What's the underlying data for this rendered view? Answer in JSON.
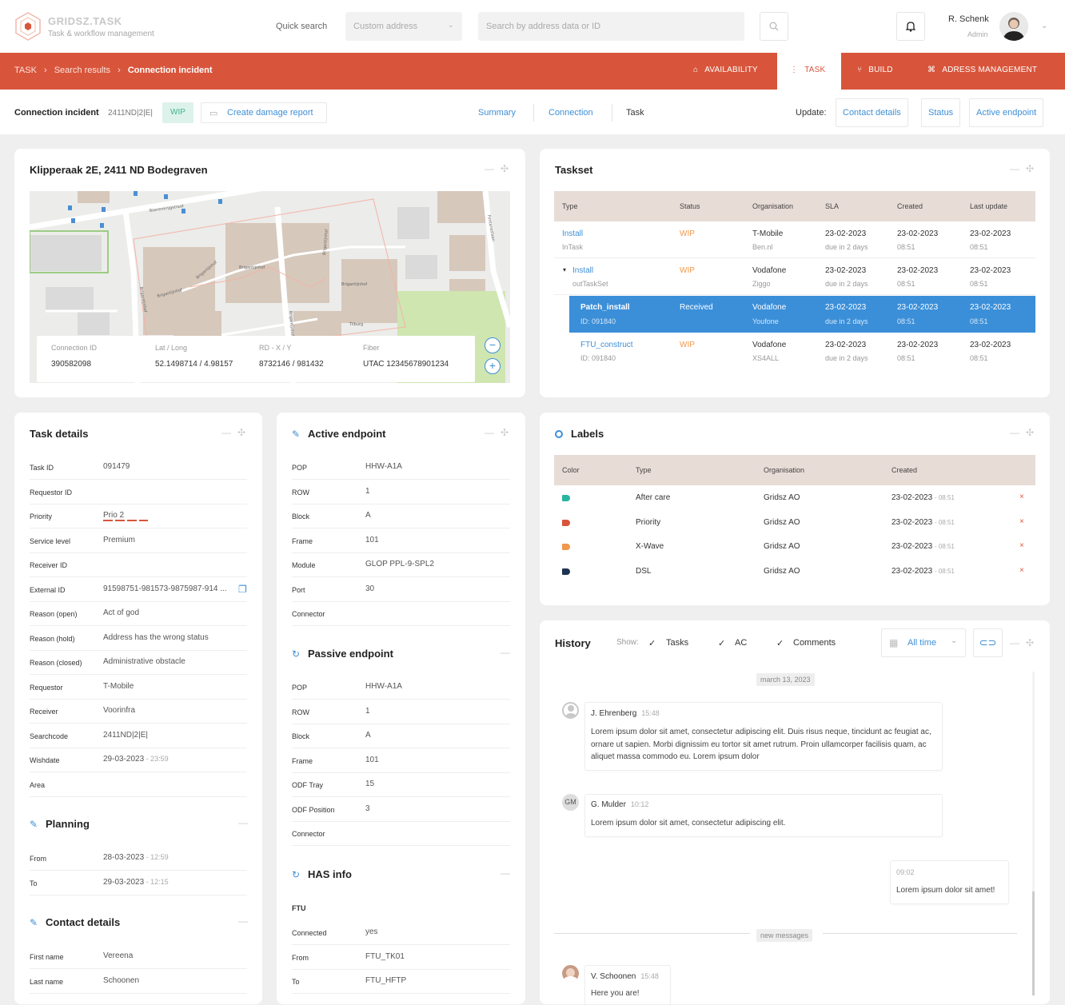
{
  "app": {
    "name": "GRIDSZ.TASK",
    "subtitle": "Task & workflow management"
  },
  "header": {
    "quick_search_label": "Quick search",
    "address_select_value": "Custom address",
    "search_placeholder": "Search by address data or ID",
    "user_name": "R. Schenk",
    "user_role": "Admin"
  },
  "nav": {
    "breadcrumb": [
      "TASK",
      "Search results",
      "Connection incident"
    ],
    "items": [
      "AVAILABILITY",
      "TASK",
      "BUILD",
      "ADRESS MANAGEMENT"
    ],
    "active": "TASK"
  },
  "subbar": {
    "title": "Connection incident",
    "code": "2411ND|2|E|",
    "status": "WIP",
    "damage_report": "Create damage report",
    "tabs": [
      "Summary",
      "Connection",
      "Task"
    ],
    "update_label": "Update:",
    "update_buttons": [
      "Contact details",
      "Status",
      "Active endpoint"
    ]
  },
  "map_card": {
    "title": "Klipperaak 2E, 2411 ND Bodegraven",
    "fields": [
      {
        "label": "Connection ID",
        "value": "390582098"
      },
      {
        "label": "Lat / Long",
        "value": "52.1498714 / 4.98157"
      },
      {
        "label": "RD - X / Y",
        "value": "8732146 / 981432"
      },
      {
        "label": "Fiber",
        "value": "UTAC 12345678901234"
      }
    ],
    "streets": [
      "Boerenkrijgstraat",
      "Brigantijnhof",
      "Brigantijnhof",
      "Brigantijnhof",
      "Brigantijnhof",
      "Brigantijnhof",
      "Brigantijnhof",
      "Brigantijnhof",
      "Fontaneslaan",
      "Tilburg"
    ]
  },
  "taskset": {
    "title": "Taskset",
    "headers": [
      "Type",
      "Status",
      "Organisation",
      "SLA",
      "Created",
      "Last update"
    ],
    "rows": [
      {
        "type": "Install",
        "type_sub": "InTask",
        "status": "WIP",
        "org": "T-Mobile",
        "org_sub": "Ben.nl",
        "sla": "23-02-2023",
        "sla_sub": "due in 2 days",
        "created": "23-02-2023",
        "created_sub": "08:51",
        "updated": "23-02-2023",
        "updated_sub": "08:51"
      },
      {
        "type": "Install",
        "type_sub": "outTaskSet",
        "status": "WIP",
        "org": "Vodafone",
        "org_sub": "Ziggo",
        "sla": "23-02-2023",
        "sla_sub": "due in 2 days",
        "created": "23-02-2023",
        "created_sub": "08:51",
        "updated": "23-02-2023",
        "updated_sub": "08:51"
      },
      {
        "type": "Patch_install",
        "type_sub": "ID: 091840",
        "status": "Received",
        "org": "Vodafone",
        "org_sub": "Youfone",
        "sla": "23-02-2023",
        "sla_sub": "due in 2 days",
        "created": "23-02-2023",
        "created_sub": "08:51",
        "updated": "23-02-2023",
        "updated_sub": "08:51"
      },
      {
        "type": "FTU_construct",
        "type_sub": "ID: 091840",
        "status": "WIP",
        "org": "Vodafone",
        "org_sub": "XS4ALL",
        "sla": "23-02-2023",
        "sla_sub": "due in 2 days",
        "created": "23-02-2023",
        "created_sub": "08:51",
        "updated": "23-02-2023",
        "updated_sub": "08:51"
      }
    ]
  },
  "task_details": {
    "title": "Task details",
    "rows": [
      {
        "label": "Task ID",
        "value": "091479"
      },
      {
        "label": "Requestor ID",
        "value": ""
      },
      {
        "label": "Priority",
        "value": "Prio 2"
      },
      {
        "label": "Service level",
        "value": "Premium"
      },
      {
        "label": "Receiver ID",
        "value": ""
      },
      {
        "label": "External ID",
        "value": "91598751-981573-9875987-914 ..."
      },
      {
        "label": "Reason (open)",
        "value": "Act of god"
      },
      {
        "label": "Reason (hold)",
        "value": "Address has the wrong status"
      },
      {
        "label": "Reason (closed)",
        "value": "Administrative obstacle"
      },
      {
        "label": "Requestor",
        "value": "T-Mobile"
      },
      {
        "label": "Receiver",
        "value": "Voorinfra"
      },
      {
        "label": "Searchcode",
        "value": "2411ND|2|E|"
      },
      {
        "label": "Wishdate",
        "value": "29-03-2023",
        "value_sub": "23:59"
      },
      {
        "label": "Area",
        "value": ""
      }
    ],
    "planning_title": "Planning",
    "planning": [
      {
        "label": "From",
        "value": "28-03-2023",
        "value_sub": "12:59"
      },
      {
        "label": "To",
        "value": "29-03-2023",
        "value_sub": "12:15"
      }
    ],
    "contact_title": "Contact details",
    "contact": [
      {
        "label": "First name",
        "value": "Vereena"
      },
      {
        "label": "Last name",
        "value": "Schoonen"
      }
    ]
  },
  "endpoints": {
    "active_title": "Active endpoint",
    "active": [
      {
        "label": "POP",
        "value": "HHW-A1A"
      },
      {
        "label": "ROW",
        "value": "1"
      },
      {
        "label": "Block",
        "value": "A"
      },
      {
        "label": "Frame",
        "value": "101"
      },
      {
        "label": "Module",
        "value": "GLOP PPL-9-SPL2"
      },
      {
        "label": "Port",
        "value": "30"
      },
      {
        "label": "Connector",
        "value": ""
      }
    ],
    "passive_title": "Passive endpoint",
    "passive": [
      {
        "label": "POP",
        "value": "HHW-A1A"
      },
      {
        "label": "ROW",
        "value": "1"
      },
      {
        "label": "Block",
        "value": "A"
      },
      {
        "label": "Frame",
        "value": "101"
      },
      {
        "label": "ODF Tray",
        "value": "15"
      },
      {
        "label": "ODF Position",
        "value": "3"
      },
      {
        "label": "Connector",
        "value": ""
      }
    ],
    "has_title": "HAS info",
    "has_sub": "FTU",
    "has": [
      {
        "label": "Connected",
        "value": "yes"
      },
      {
        "label": "From",
        "value": "FTU_TK01"
      },
      {
        "label": "To",
        "value": "FTU_HFTP"
      }
    ]
  },
  "labels": {
    "title": "Labels",
    "headers": [
      "Color",
      "Type",
      "Organisation",
      "Created"
    ],
    "rows": [
      {
        "color": "#2bb5a0",
        "type": "After care",
        "org": "Gridsz AO",
        "created": "23-02-2023",
        "time": "- 08:51"
      },
      {
        "color": "#d8553b",
        "type": "Priority",
        "org": "Gridsz AO",
        "created": "23-02-2023",
        "time": "- 08:51"
      },
      {
        "color": "#f0974a",
        "type": "X-Wave",
        "org": "Gridsz AO",
        "created": "23-02-2023",
        "time": "- 08:51"
      },
      {
        "color": "#1e3350",
        "type": "DSL",
        "org": "Gridsz AO",
        "created": "23-02-2023",
        "time": "- 08:51"
      }
    ]
  },
  "history": {
    "title": "History",
    "show_label": "Show:",
    "filters": [
      "Tasks",
      "AC",
      "Comments"
    ],
    "range": "All time",
    "date_sep": "march 13, 2023",
    "new_sep": "new messages",
    "messages": [
      {
        "author": "J. Ehrenberg",
        "time": "15:48",
        "text": "Lorem ipsum dolor sit amet, consectetur adipiscing elit. Duis risus neque, tincidunt ac feugiat ac, ornare ut sapien. Morbi dignissim eu tortor sit amet rutrum. Proin ullamcorper facilisis quam, ac aliquet massa commodo eu. Lorem ipsum dolor"
      },
      {
        "author": "G. Mulder",
        "initials": "GM",
        "time": "10:12",
        "text": "Lorem ipsum dolor sit amet, consectetur adipiscing elit."
      },
      {
        "time": "09:02",
        "text": "Lorem ipsum dolor sit amet!"
      },
      {
        "author": "V. Schoonen",
        "time": "15:48",
        "text": "Here you are!"
      }
    ]
  },
  "colors": {
    "brand_red": "#d8553b",
    "link_blue": "#3e8fd6",
    "selected_row": "#3b8fd8",
    "wip_orange": "#f0974a"
  }
}
